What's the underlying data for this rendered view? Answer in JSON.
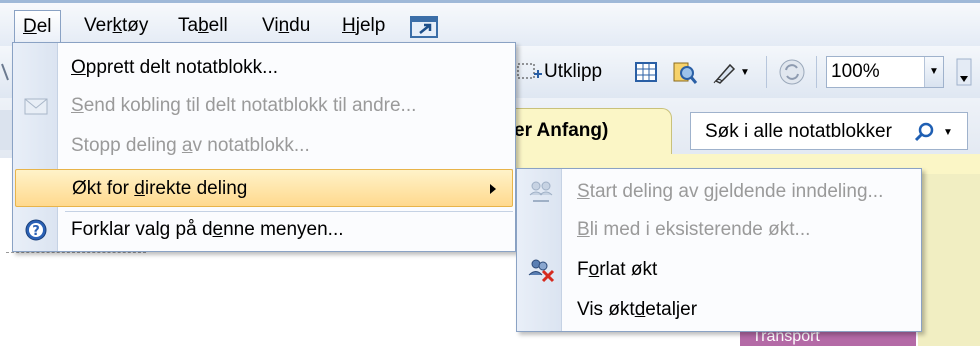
{
  "menubar": {
    "items": [
      {
        "label": "Del",
        "accel": "D",
        "rest": "el"
      },
      {
        "label": "Verktøy",
        "pre": "Ver",
        "accel": "k",
        "rest": "tøy"
      },
      {
        "label": "Tabell",
        "pre": "Ta",
        "accel": "b",
        "rest": "ell"
      },
      {
        "label": "Vindu",
        "pre": "Vi",
        "accel": "n",
        "rest": "du"
      },
      {
        "label": "Hjelp",
        "pre": "",
        "accel": "H",
        "rest": "jelp"
      }
    ]
  },
  "toolbar": {
    "clip_label": "Utklipp",
    "zoom_value": "100%"
  },
  "tabs": {
    "page_tab_label": "er Anfang)"
  },
  "search": {
    "placeholder": "Søk i alle notatblokker"
  },
  "menu": {
    "items": [
      {
        "pre": "",
        "accel": "O",
        "rest": "pprett delt notatblokk...",
        "enabled": true
      },
      {
        "pre": "",
        "accel": "S",
        "rest": "end kobling til delt notatblokk til andre...",
        "enabled": false
      },
      {
        "pre": "Stopp deling ",
        "accel": "a",
        "rest": "v notatblokk...",
        "enabled": false
      },
      {
        "pre": "Økt for ",
        "accel": "d",
        "rest": "irekte deling",
        "enabled": true,
        "highlighted": true
      },
      {
        "pre": "Forklar valg på d",
        "accel": "e",
        "rest": "nne menyen...",
        "enabled": true
      }
    ]
  },
  "submenu": {
    "items": [
      {
        "pre": "",
        "accel": "S",
        "rest": "tart deling av gjeldende inndeling...",
        "enabled": false
      },
      {
        "pre": "",
        "accel": "B",
        "rest": "li med i eksisterende økt...",
        "enabled": false
      },
      {
        "pre": "F",
        "accel": "o",
        "rest": "rlat økt",
        "enabled": true
      },
      {
        "pre": "Vis økt",
        "accel": "d",
        "rest": "etaljer",
        "enabled": true
      }
    ]
  },
  "content": {
    "section_label": "Transport"
  }
}
